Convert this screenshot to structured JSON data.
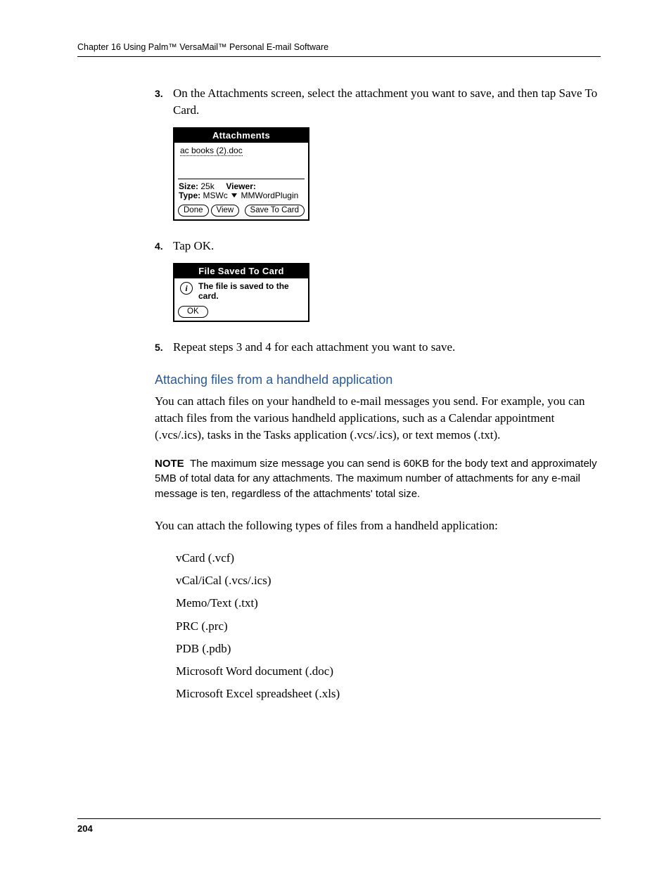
{
  "header": {
    "running": "Chapter 16   Using Palm™ VersaMail™ Personal E-mail Software"
  },
  "steps": {
    "s3": {
      "num": "3.",
      "text": "On the Attachments screen, select the attachment you want to save, and then tap Save To Card."
    },
    "s4": {
      "num": "4.",
      "text": "Tap OK."
    },
    "s5": {
      "num": "5.",
      "text": "Repeat steps 3 and 4 for each attachment you want to save."
    }
  },
  "attachments_screen": {
    "title": "Attachments",
    "filename": "ac books (2).doc",
    "size_label": "Size:",
    "size_value": "25k",
    "viewer_label": "Viewer:",
    "type_label": "Type:",
    "type_value": "MSWc",
    "plugin": "MMWordPlugin",
    "btn_done": "Done",
    "btn_view": "View",
    "btn_save": "Save To Card"
  },
  "dialog": {
    "title": "File Saved To Card",
    "message": "The file is saved to the card.",
    "btn_ok": "OK"
  },
  "section": {
    "heading": "Attaching files from a handheld application",
    "intro": "You can attach files on your handheld to e-mail messages you send. For example, you can attach files from the various handheld applications, such as a Calendar appointment (.vcs/.ics), tasks in the Tasks application (.vcs/.ics), or text memos (.txt).",
    "note_label": "NOTE",
    "note_body": "The maximum size message you can send is 60KB for the body text and approximately 5MB of total data for any attachments. The maximum number of attachments for any e-mail message is ten, regardless of the attachments' total size.",
    "following": "You can attach the following types of files from a handheld application:",
    "files": {
      "f1": "vCard (.vcf)",
      "f2": "vCal/iCal (.vcs/.ics)",
      "f3": "Memo/Text (.txt)",
      "f4": "PRC (.prc)",
      "f5": "PDB (.pdb)",
      "f6": "Microsoft Word document (.doc)",
      "f7": "Microsoft Excel spreadsheet (.xls)"
    }
  },
  "footer": {
    "page_num": "204"
  }
}
